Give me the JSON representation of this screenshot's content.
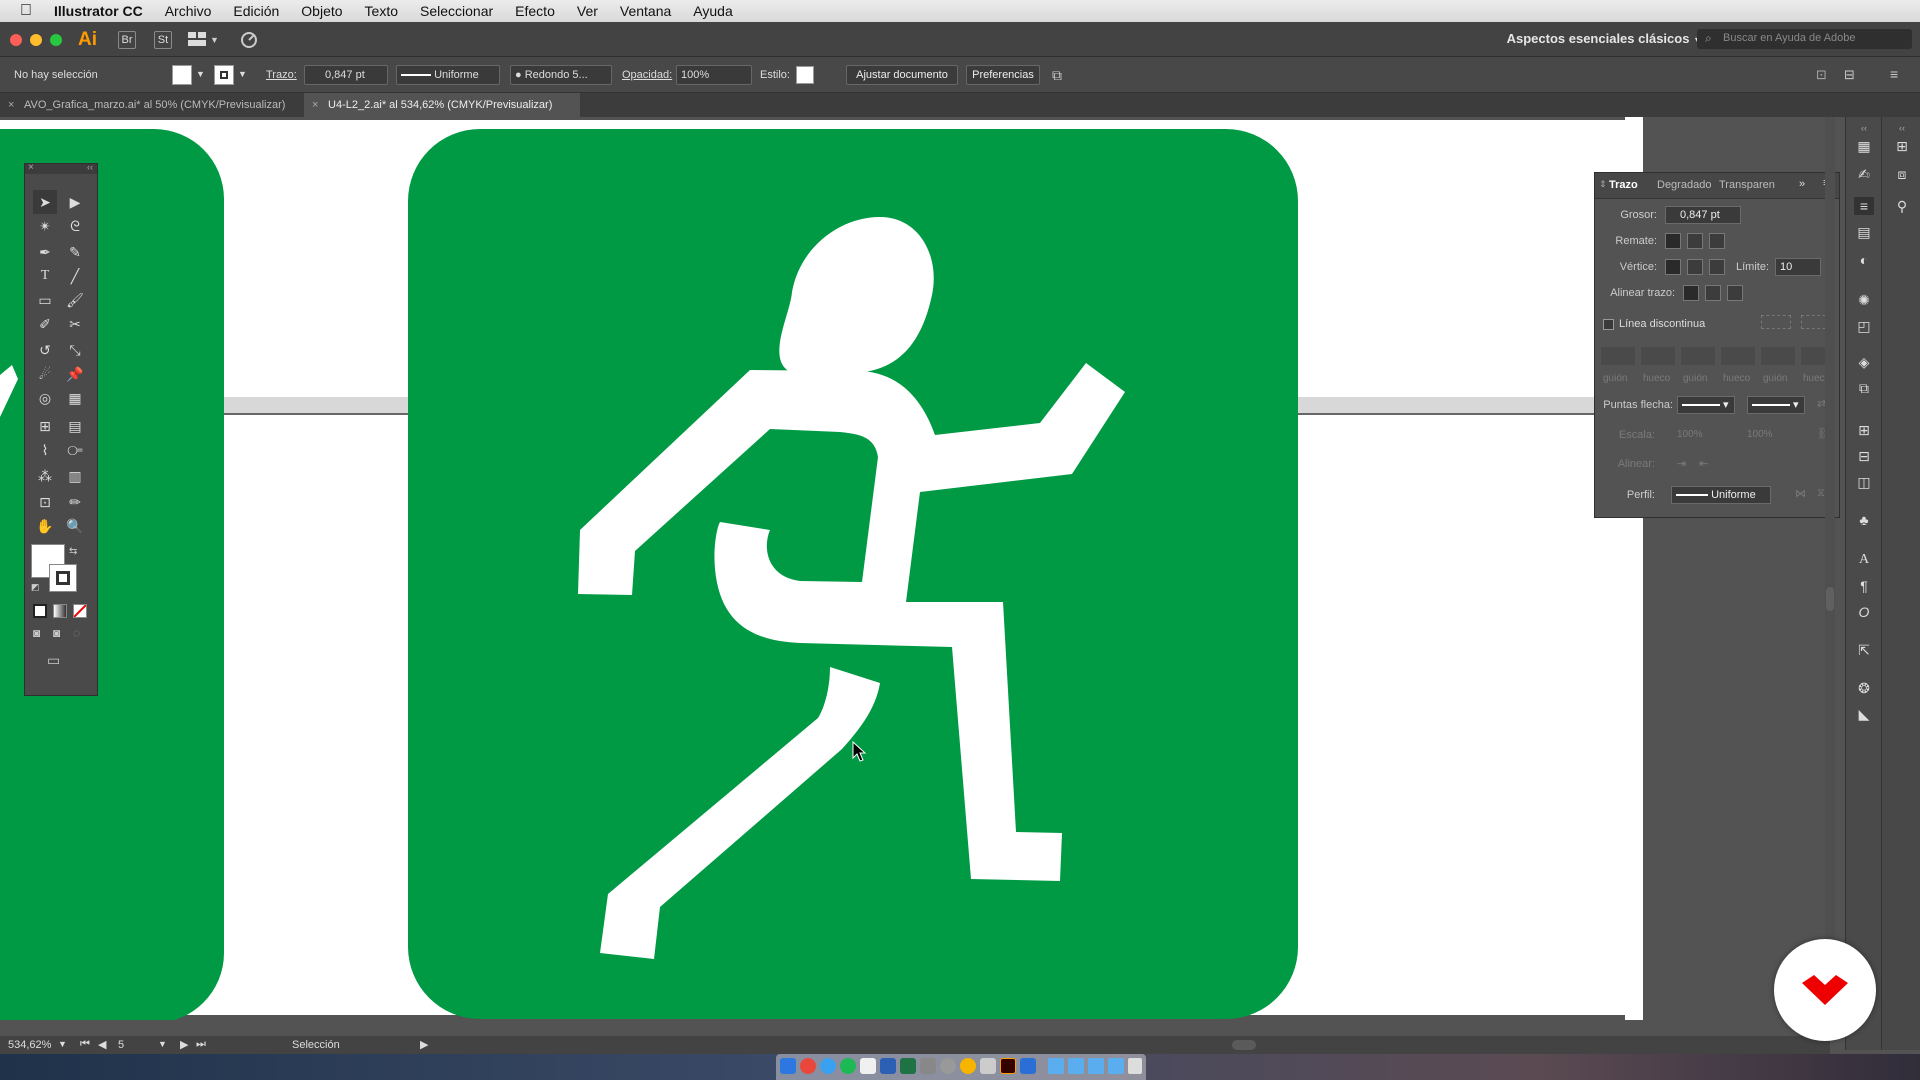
{
  "menubar": {
    "app_name": "Illustrator CC",
    "items": [
      "Archivo",
      "Edición",
      "Objeto",
      "Texto",
      "Seleccionar",
      "Efecto",
      "Ver",
      "Ventana",
      "Ayuda"
    ]
  },
  "appbar": {
    "logo": "Ai",
    "bridge": "Br",
    "stock": "St",
    "workspace": "Aspectos esenciales clásicos",
    "search_placeholder": "Buscar en Ayuda de Adobe"
  },
  "controlbar": {
    "selection_status": "No hay selección",
    "stroke_label": "Trazo:",
    "stroke_value": "0,847 pt",
    "stroke_style": "Uniforme",
    "brush": "Redondo 5...",
    "opacity_label": "Opacidad:",
    "opacity_value": "100%",
    "style_label": "Estilo:",
    "adjust_doc": "Ajustar documento",
    "preferences": "Preferencias"
  },
  "tabs": [
    {
      "label": "AVO_Grafica_marzo.ai* al 50% (CMYK/Previsualizar)"
    },
    {
      "label": "U4-L2_2.ai* al 534,62% (CMYK/Previsualizar)"
    }
  ],
  "stroke_panel": {
    "tabs": [
      "Trazo",
      "Degradado",
      "Transparen"
    ],
    "weight_label": "Grosor:",
    "weight_value": "0,847 pt",
    "cap_label": "Remate:",
    "corner_label": "Vértice:",
    "limit_label": "Límite:",
    "limit_value": "10",
    "limit_x": "x",
    "align_label": "Alinear trazo:",
    "dashed_label": "Línea discontinua",
    "dash_labels": [
      "guión",
      "hueco",
      "guión",
      "hueco",
      "guión",
      "hueco"
    ],
    "arrows_label": "Puntas flecha:",
    "scale_label": "Escala:",
    "scale_value_1": "100%",
    "scale_value_2": "100%",
    "align_arrows_label": "Alinear:",
    "profile_label": "Perfil:",
    "profile_value": "Uniforme"
  },
  "statusbar": {
    "zoom": "534,62%",
    "artboard_number": "5",
    "tool": "Selección"
  },
  "colors": {
    "sign_green": "#009a44",
    "artboard": "#ffffff",
    "ui_dark": "#535353"
  }
}
